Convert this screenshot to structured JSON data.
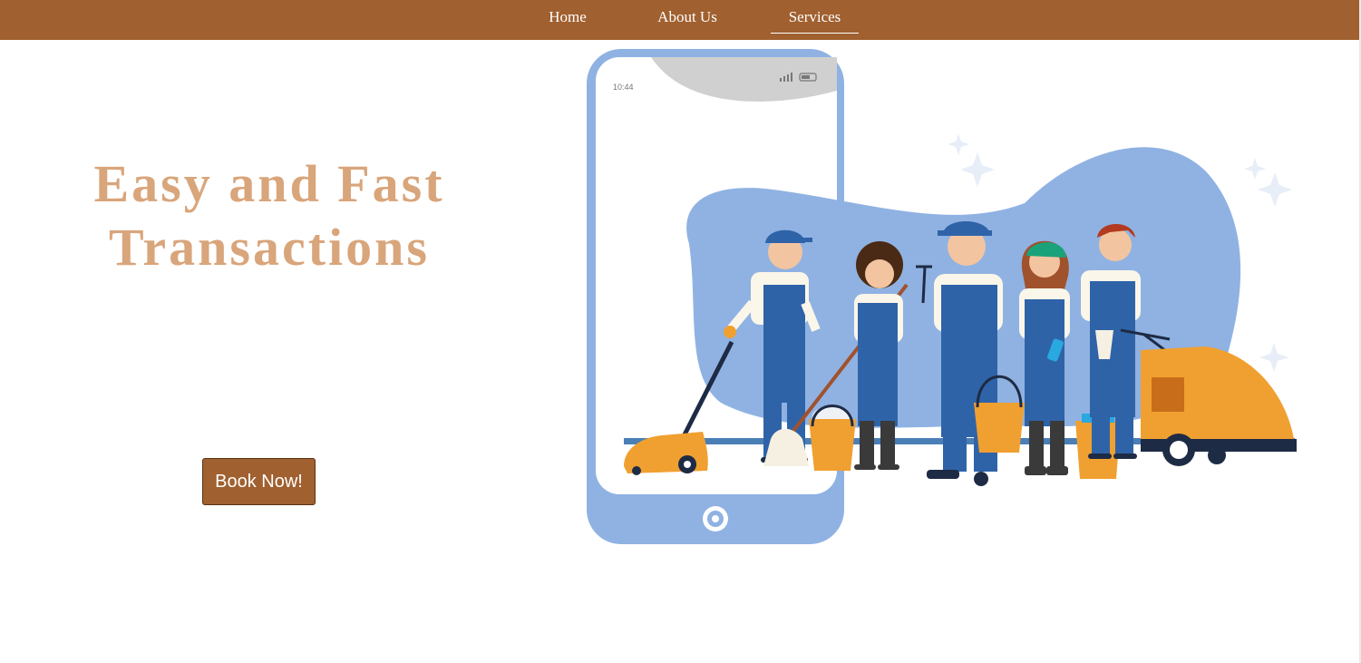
{
  "nav": {
    "items": [
      {
        "label": "Home"
      },
      {
        "label": "About Us"
      },
      {
        "label": "Services",
        "active": true
      }
    ]
  },
  "hero": {
    "title_line1": "Easy and Fast",
    "title_line2": "Transactions",
    "book_button": "Book Now!"
  },
  "illustration": {
    "phone_time": "10:44",
    "icons": [
      "phone-icon",
      "signal-icon",
      "battery-icon",
      "home-button-icon",
      "sparkle-icon"
    ]
  },
  "colors": {
    "brand": "#a0602f",
    "title": "#d9a57b",
    "illustration_blue": "#8fb2e2",
    "uniform_blue": "#2f63a8",
    "equipment_orange": "#f0a030"
  }
}
